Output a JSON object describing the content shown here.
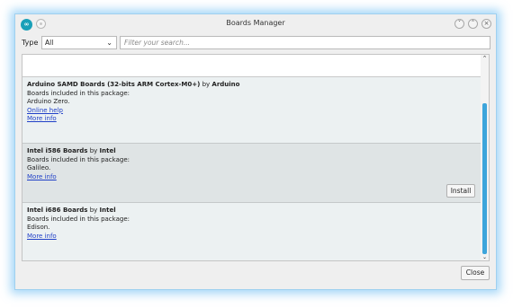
{
  "window": {
    "title": "Boards Manager",
    "app_icon_text": "∞"
  },
  "filter": {
    "type_label": "Type",
    "type_value": "All",
    "search_placeholder": "Filter your search..."
  },
  "entries": [
    {
      "name": "Arduino SAMD Boards (32-bits ARM Cortex-M0+)",
      "by": "by",
      "author": "Arduino",
      "included_label": "Boards included in this package:",
      "boards": "Arduino Zero.",
      "online_help": "Online help",
      "more_info": "More info"
    },
    {
      "name": "Intel i586 Boards",
      "by": "by",
      "author": "Intel",
      "included_label": "Boards included in this package:",
      "boards": "Galileo.",
      "more_info": "More info",
      "install_label": "Install"
    },
    {
      "name": "Intel i686 Boards",
      "by": "by",
      "author": "Intel",
      "included_label": "Boards included in this package:",
      "boards": "Edison.",
      "more_info": "More info"
    }
  ],
  "footer": {
    "close_label": "Close"
  },
  "colors": {
    "accent": "#3da5db",
    "link": "#1f3fc7",
    "selected_row": "#dfe4e5"
  }
}
